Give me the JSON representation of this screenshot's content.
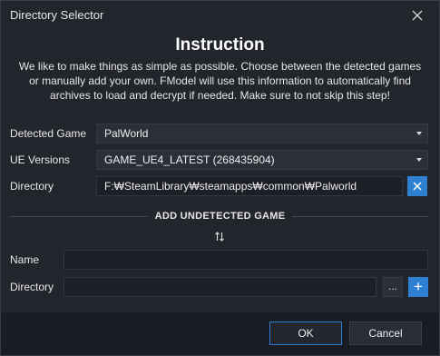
{
  "window": {
    "title": "Directory Selector",
    "close_icon": "close-icon"
  },
  "instruction": {
    "heading": "Instruction",
    "line1": "We like to make things as simple as possible. Choose between the detected games",
    "line2": "or manually add your own. FModel will use this information to automatically find",
    "line3": "archives to load and decrypt if needed. Make sure to not skip this step!"
  },
  "detected": {
    "game_label": "Detected Game",
    "game_value": "PalWorld",
    "ue_label": "UE Versions",
    "ue_value": "GAME_UE4_LATEST (268435904)",
    "dir_label": "Directory",
    "dir_value": "F:₩SteamLibrary₩steamapps₩common₩Palworld"
  },
  "add_section": {
    "title": "ADD UNDETECTED GAME",
    "name_label": "Name",
    "name_value": "",
    "dir_label": "Directory",
    "dir_value": "",
    "browse_label": "...",
    "add_label": "+"
  },
  "footer": {
    "ok_label": "OK",
    "cancel_label": "Cancel"
  },
  "colors": {
    "accent": "#2f7fd3",
    "background": "#23252d",
    "footer": "#1a1c23"
  }
}
